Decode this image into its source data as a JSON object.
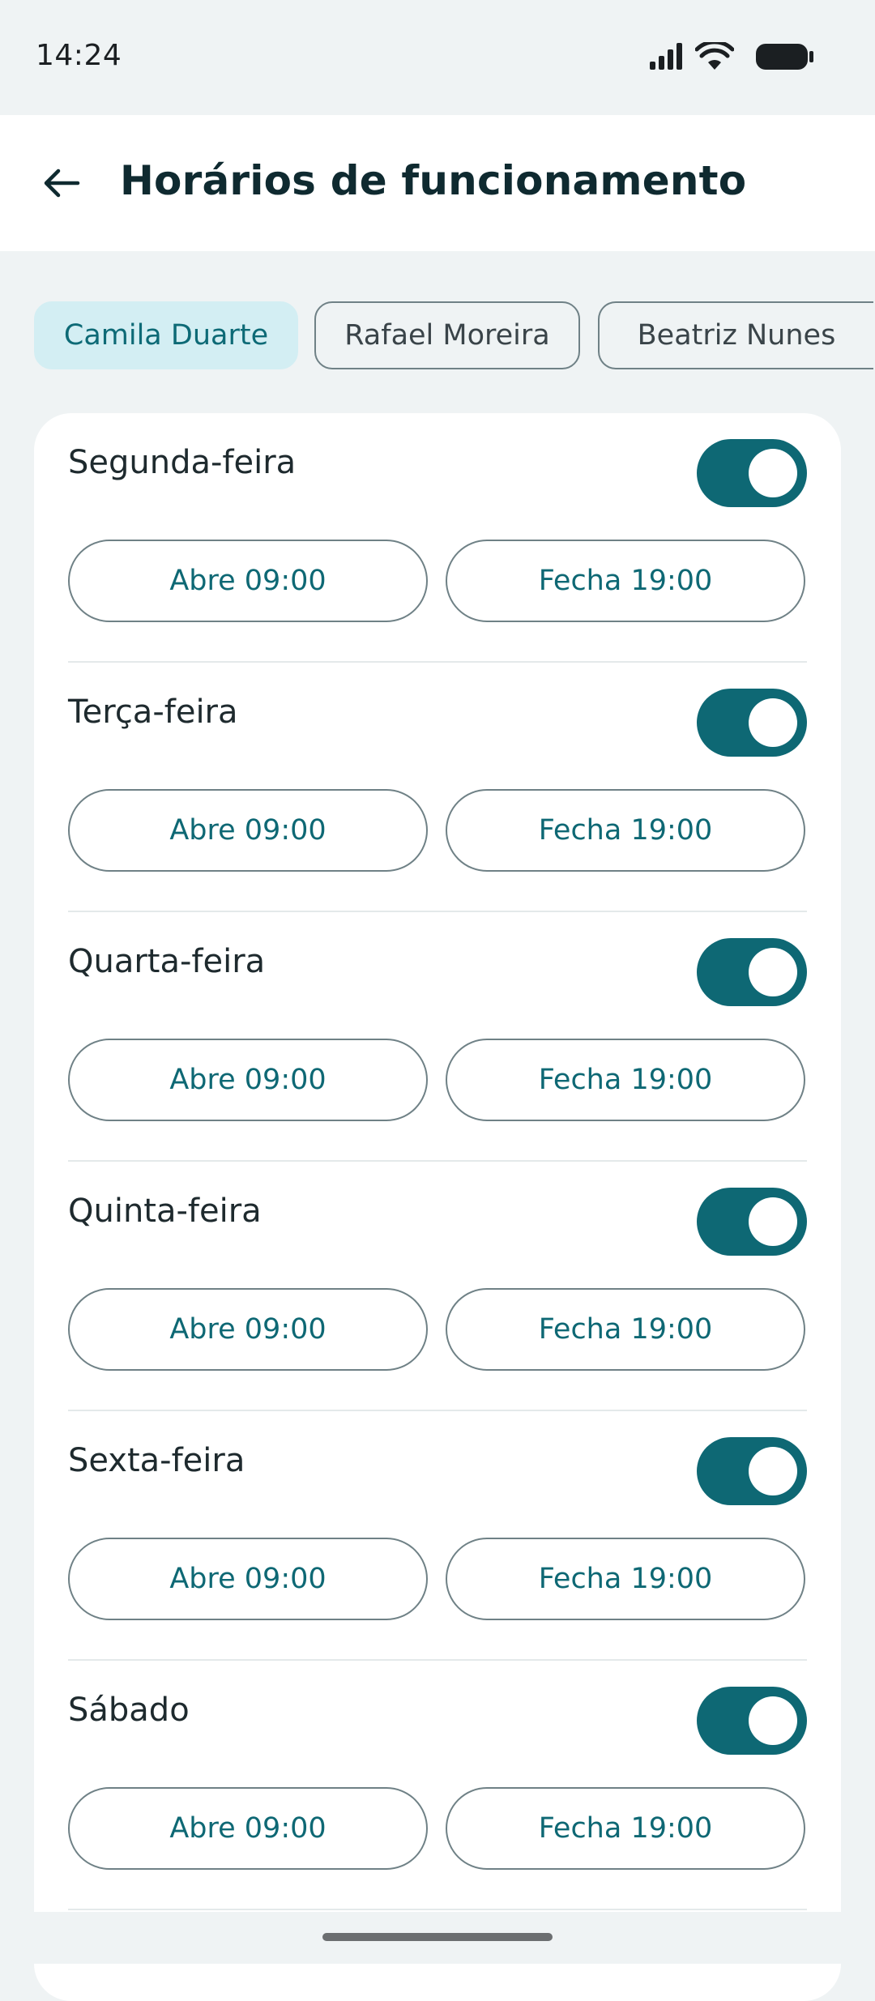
{
  "status_bar": {
    "time": "14:24",
    "icons": [
      "signal-icon",
      "wifi-icon",
      "battery-icon"
    ]
  },
  "app_bar": {
    "back_icon": "arrow-left-icon",
    "title": "Horários de funcionamento"
  },
  "staff_chips": [
    {
      "label": "Camila Duarte",
      "selected": true
    },
    {
      "label": "Rafael Moreira",
      "selected": false
    },
    {
      "label": "Beatriz Nunes",
      "selected": false
    }
  ],
  "days": [
    {
      "name": "Segunda-feira",
      "enabled": true,
      "open_label": "Abre 09:00",
      "close_label": "Fecha 19:00"
    },
    {
      "name": "Terça-feira",
      "enabled": true,
      "open_label": "Abre 09:00",
      "close_label": "Fecha 19:00"
    },
    {
      "name": "Quarta-feira",
      "enabled": true,
      "open_label": "Abre 09:00",
      "close_label": "Fecha 19:00"
    },
    {
      "name": "Quinta-feira",
      "enabled": true,
      "open_label": "Abre 09:00",
      "close_label": "Fecha 19:00"
    },
    {
      "name": "Sexta-feira",
      "enabled": true,
      "open_label": "Abre 09:00",
      "close_label": "Fecha 19:00"
    },
    {
      "name": "Sábado",
      "enabled": true,
      "open_label": "Abre 09:00",
      "close_label": "Fecha 19:00"
    }
  ],
  "colors": {
    "accent": "#0e6874",
    "chip_selected_bg": "#d3eef3",
    "background": "#eff3f4",
    "card": "#ffffff"
  }
}
